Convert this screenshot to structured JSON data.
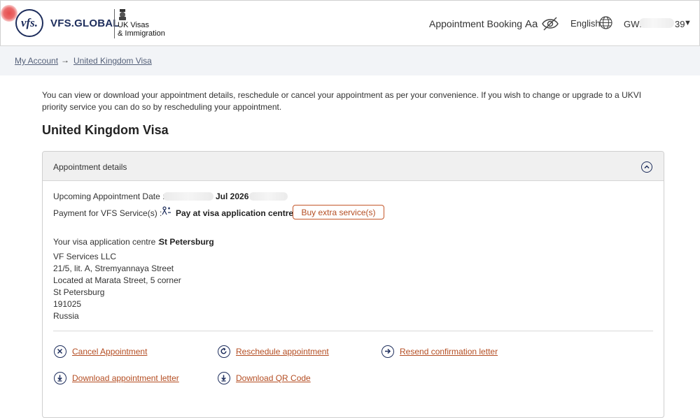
{
  "header": {
    "vfs_logo_text": "vfs.",
    "vfs_wordmark": "VFS.GLOBAL",
    "ukvi_line1": "UK Visas",
    "ukvi_line2": "& Immigration",
    "nav_booking": "Appointment Booking",
    "text_size_icon": "Aa",
    "language": "English",
    "user_prefix": "GWF",
    "user_suffix": "39",
    "user_caret": "▼"
  },
  "breadcrumb": {
    "items": [
      "My Account",
      "United Kingdom Visa"
    ],
    "separator": "→"
  },
  "intro_text": "You can view or download your appointment details, reschedule or cancel your appointment as per your convenience. If you wish to change or upgrade to a UKVI priority service you can do so by rescheduling your appointment.",
  "page_title": "United Kingdom Visa",
  "card": {
    "title": "Appointment details",
    "upcoming_label": "Upcoming Appointment Date :",
    "upcoming_value": "Jul 2026",
    "payment_label": "Payment for VFS Service(s) :",
    "payment_value": "Pay at visa application centre",
    "buy_button": "Buy extra service(s)",
    "centre_label": "Your visa application centre :",
    "centre_value": "St Petersburg",
    "address": [
      "VF Services LLC",
      "21/5, lit. A, Stremyannaya Street",
      "Located at Marata Street, 5 corner",
      "St Petersburg",
      "191025",
      "Russia"
    ],
    "actions": {
      "cancel": "Cancel Appointment",
      "reschedule": "Reschedule appointment",
      "resend": "Resend confirmation letter",
      "download_letter": "Download appointment letter",
      "download_qr": "Download QR Code"
    }
  },
  "colors": {
    "navy": "#1d2d5c",
    "link_orange": "#b44d22",
    "breadcrumb_bg": "#f2f4f7",
    "card_header_bg": "#f0f0f0"
  },
  "icons": {
    "logo": "vfs-logo-icon",
    "crest": "royal-crest-icon",
    "eye": "eye-off-icon",
    "globe": "globe-icon",
    "collapse": "chevron-up-icon",
    "payment": "pay-icon",
    "cancel": "x-circle-icon",
    "reschedule": "refresh-circle-icon",
    "resend": "arrow-right-circle-icon",
    "download": "download-circle-icon"
  }
}
